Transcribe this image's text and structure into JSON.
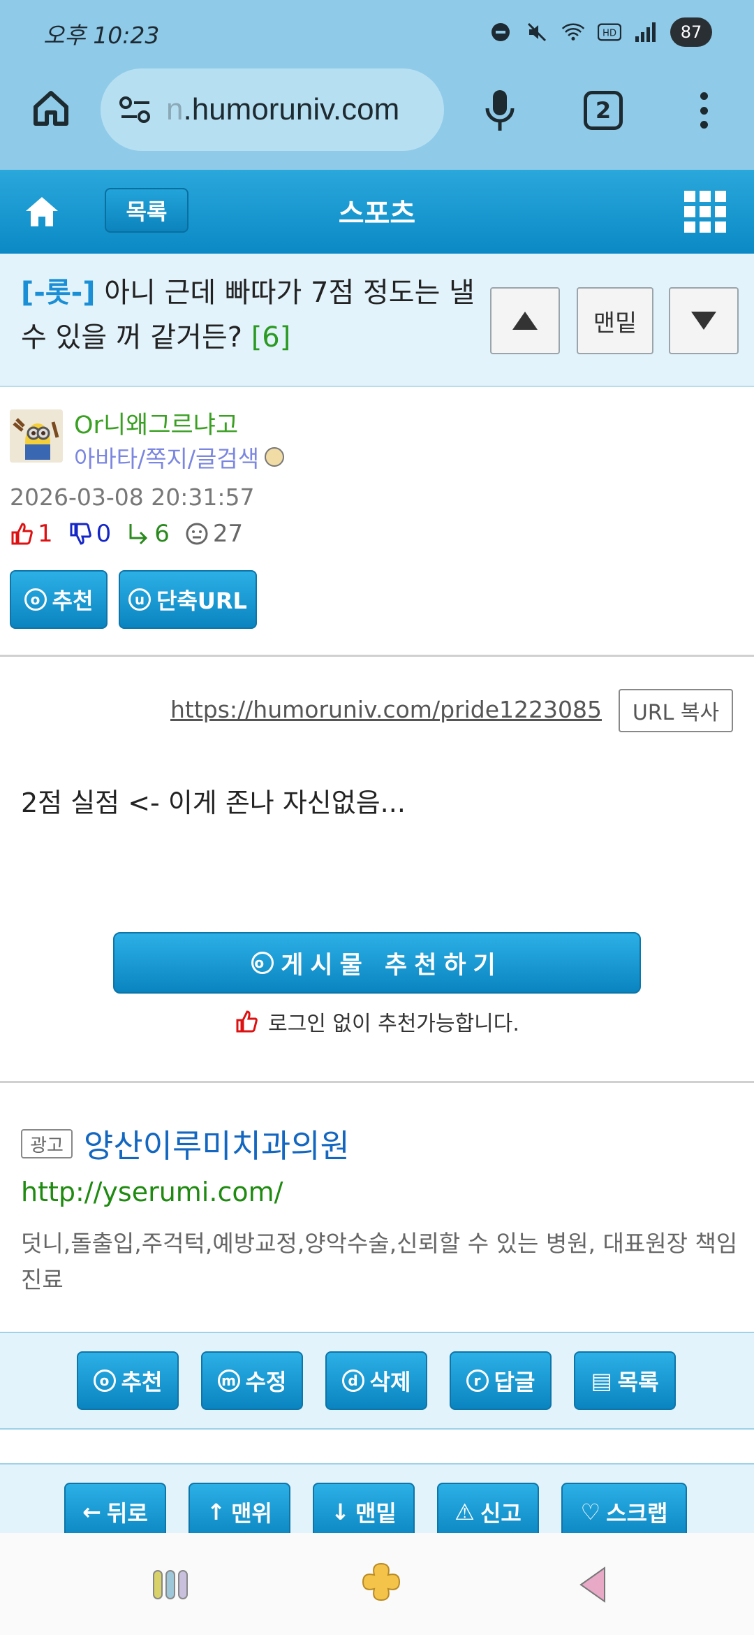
{
  "status_bar": {
    "time": "오후 10:23",
    "battery": "87"
  },
  "browser": {
    "url_prefix": "n",
    "url_main": ".humoruniv.com",
    "tab_count": "2"
  },
  "site_nav": {
    "list_label": "목록",
    "section_title": "스포츠"
  },
  "post": {
    "tag": "[-롯-]",
    "title": "아니 근데 빠따가 7점 정도는 낼 수 있을 꺼 같거든?",
    "comment_count": "[6]",
    "nav_bottom_label": "맨밑"
  },
  "author": {
    "nickname": "Or니왜그르냐고",
    "links": "아바타/쪽지/글검색",
    "date": "2026-03-08 20:31:57",
    "stats": {
      "up": "1",
      "down": "0",
      "replies": "6",
      "views": "27"
    },
    "recommend_label": "추천",
    "short_url_label": "단축URL"
  },
  "content": {
    "permalink": "https://humoruniv.com/pride1223085",
    "copy_label": "URL 복사",
    "text": "2점 실점 <- 이게 존나 자신없음...",
    "big_recommend_label": "게시물 추천하기",
    "recommend_note": "로그인 없이 추천가능합니다."
  },
  "ad": {
    "tag": "광고",
    "title": "양산이루미치과의원",
    "url": "http://yserumi.com/",
    "description": "덧니,돌출입,주걱턱,예방교정,양악수술,신뢰할 수 있는 병원, 대표원장 책임진료"
  },
  "actions_row1": [
    {
      "key": "o",
      "label": "추천"
    },
    {
      "key": "m",
      "label": "수정"
    },
    {
      "key": "d",
      "label": "삭제"
    },
    {
      "key": "r",
      "label": "답글"
    },
    {
      "key": "▤",
      "label": "목록"
    }
  ],
  "actions_row2": [
    {
      "key": "←",
      "label": "뒤로"
    },
    {
      "key": "↑",
      "label": "맨위"
    },
    {
      "key": "↓",
      "label": "맨밑"
    },
    {
      "key": "⚠",
      "label": "신고"
    },
    {
      "key": "♡",
      "label": "스크랩"
    }
  ],
  "colors": {
    "nav_blue": "#0a89c5",
    "chrome_blue": "#8fcbe8",
    "tag_blue": "#1b8fd6",
    "green": "#2a9a22"
  }
}
